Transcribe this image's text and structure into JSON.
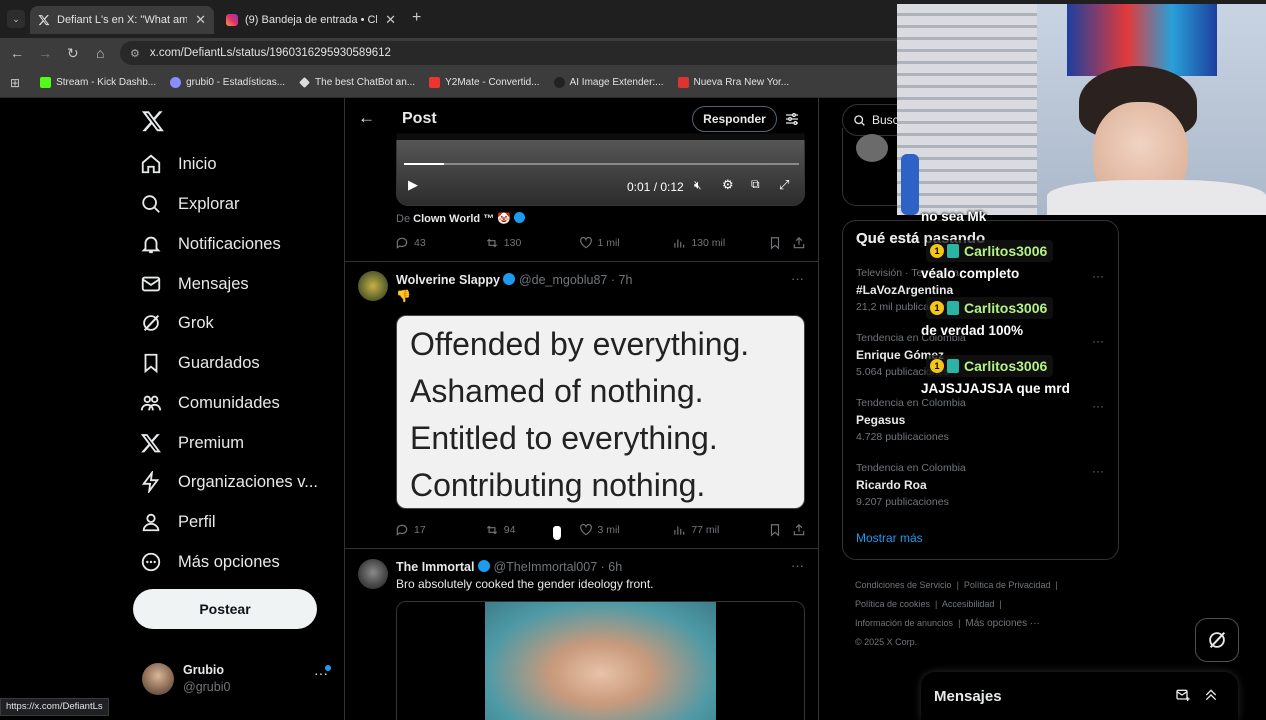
{
  "browser": {
    "tabs": [
      {
        "title": "Defiant L's en X: \"What am I wa",
        "active": true
      },
      {
        "title": "(9) Bandeja de entrada • Chats",
        "active": false
      }
    ],
    "url": "x.com/DefiantLs/status/1960316295930589612",
    "bookmarks": [
      "Stream - Kick Dashb...",
      "grubi0 - Estadísticas...",
      "The best ChatBot an...",
      "Y2Mate - Convertid...",
      "AI Image Extender:...",
      "Nueva Rra New Yor..."
    ],
    "status_url": "https://x.com/DefiantLs"
  },
  "nav": {
    "items": [
      "Inicio",
      "Explorar",
      "Notificaciones",
      "Mensajes",
      "Grok",
      "Guardados",
      "Comunidades",
      "Premium",
      "Organizaciones v...",
      "Perfil",
      "Más opciones"
    ],
    "post_label": "Postear",
    "user_name": "Grubio",
    "user_handle": "@grubi0"
  },
  "header": {
    "title": "Post",
    "reply_label": "Responder"
  },
  "video": {
    "time": "0:01 / 0:12",
    "source_prefix": "De",
    "source_name": "Clown World ™",
    "source_emoji": "🤡"
  },
  "tweets": [
    {
      "replies": "43",
      "retweets": "130",
      "likes": "1 mil",
      "views": "130 mil"
    },
    {
      "author": "Wolverine Slappy",
      "handle": "@de_mgoblu87",
      "time": "· 7h",
      "body": "👎",
      "image_lines": [
        "Offended by everything.",
        "Ashamed of nothing.",
        "Entitled to everything.",
        "Contributing nothing."
      ],
      "replies": "17",
      "retweets": "94",
      "likes": "3 mil",
      "views": "77 mil"
    },
    {
      "author": "The Immortal",
      "handle": "@TheImmortal007",
      "time": "· 6h",
      "body": "Bro absolutely cooked the gender ideology front."
    }
  ],
  "sidebar": {
    "search_placeholder": "Busca",
    "trends_title": "Qué está pasando",
    "trends": [
      {
        "context": "Televisión · Tendencia",
        "name": "#LaVozArgentina",
        "count": "21,2 mil publicaciones"
      },
      {
        "context": "Tendencia en Colombia",
        "name": "Enrique Gómez",
        "count": "5.064 publicaciones"
      },
      {
        "context": "Tendencia en Colombia",
        "name": "Pegasus",
        "count": "4.728 publicaciones"
      },
      {
        "context": "Tendencia en Colombia",
        "name": "Ricardo Roa",
        "count": "9.207 publicaciones"
      }
    ],
    "show_more": "Mostrar más",
    "footer": [
      "Condiciones de Servicio",
      "Política de Privacidad",
      "Política de cookies",
      "Accesibilidad",
      "Información de anuncios",
      "Más opciones ···",
      "© 2025 X Corp."
    ],
    "messages_title": "Mensajes"
  },
  "stream_chat": [
    {
      "user": "",
      "message": "no sea Mk"
    },
    {
      "user": "Carlitos3006",
      "message": "véalo completo"
    },
    {
      "user": "Carlitos3006",
      "message": "de verdad 100%"
    },
    {
      "user": "Carlitos3006",
      "message": "JAJSJJAJSJA que mrd"
    }
  ],
  "colors": {
    "accent": "#1d9bf0",
    "chat_name": "#b4f286",
    "bg": "#000000"
  }
}
